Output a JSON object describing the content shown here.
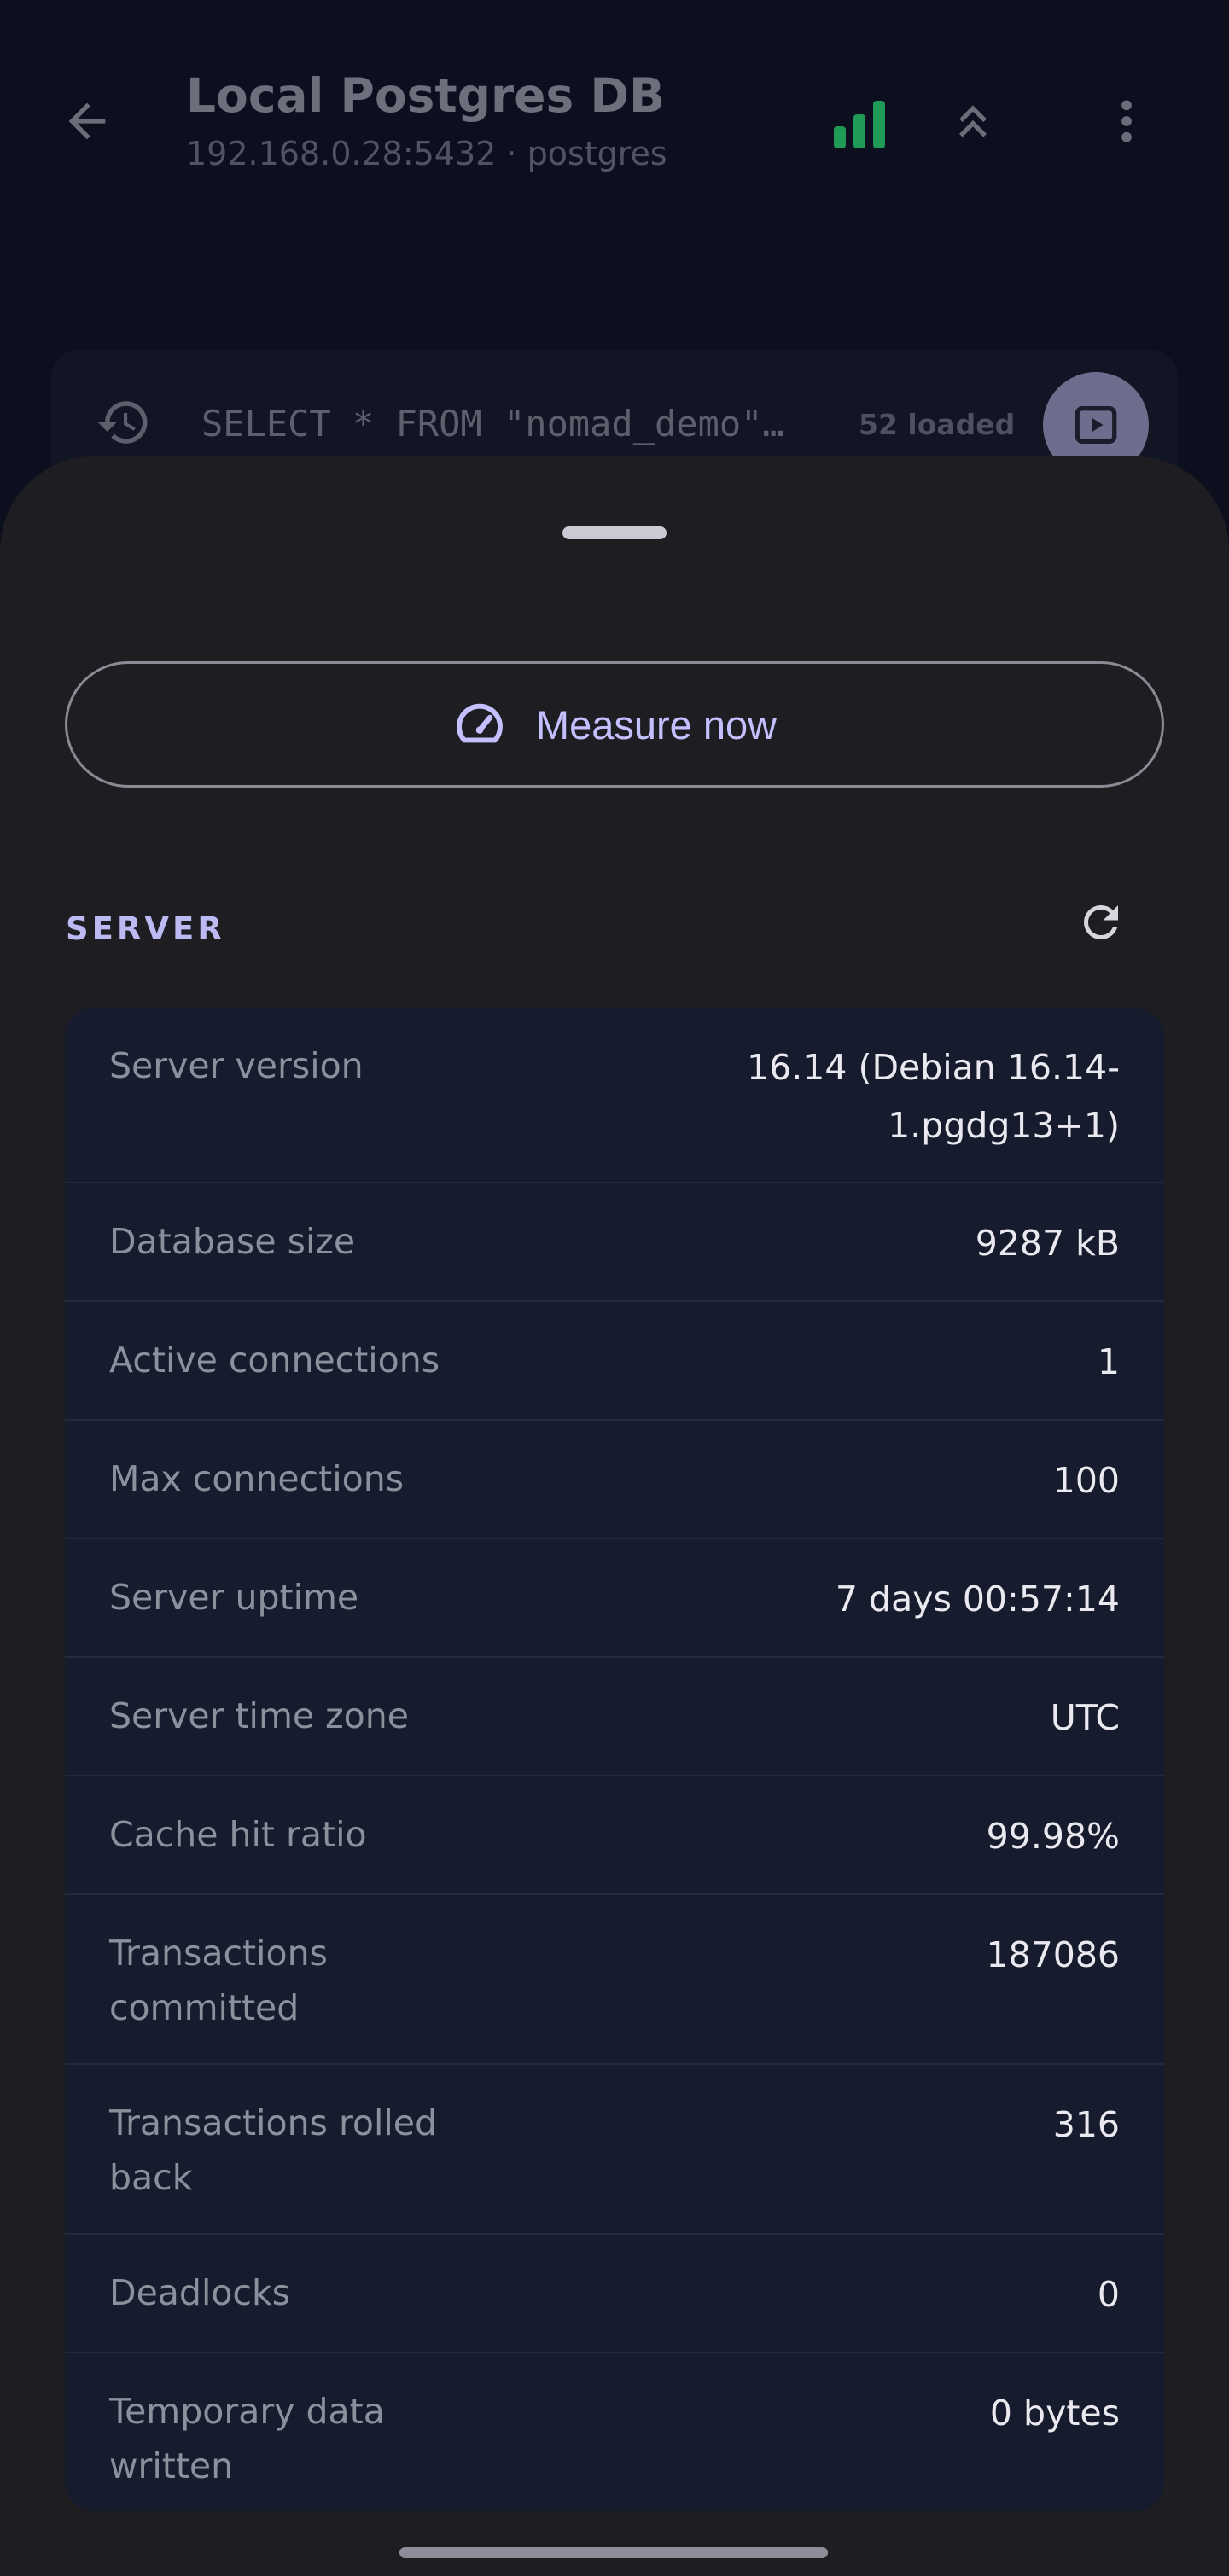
{
  "header": {
    "title": "Local Postgres DB",
    "subtitle": "192.168.0.28:5432 · postgres"
  },
  "query_bar": {
    "query": "SELECT * FROM \"nomad_demo\"…",
    "count": "52 loaded"
  },
  "sheet": {
    "measure_label": "Measure now",
    "section_title": "SERVER",
    "rows": [
      {
        "label": "Server version",
        "value": "16.14 (Debian 16.14-1.pgdg13+1)"
      },
      {
        "label": "Database size",
        "value": "9287 kB"
      },
      {
        "label": "Active connections",
        "value": "1"
      },
      {
        "label": "Max connections",
        "value": "100"
      },
      {
        "label": "Server uptime",
        "value": "7 days 00:57:14"
      },
      {
        "label": "Server time zone",
        "value": "UTC"
      },
      {
        "label": "Cache hit ratio",
        "value": "99.98%"
      },
      {
        "label": "Transactions committed",
        "value": "187086"
      },
      {
        "label": "Transactions rolled back",
        "value": "316"
      },
      {
        "label": "Deadlocks",
        "value": "0"
      },
      {
        "label": "Temporary data written",
        "value": "0 bytes"
      }
    ]
  },
  "colors": {
    "accent": "#c4c0ff",
    "signal_green": "#1f9a57",
    "sheet_bg": "#1d1d22",
    "table_bg": "#161c2d"
  },
  "icons": {
    "back": "arrow-left-icon",
    "signal": "signal-bars-icon",
    "collapse": "double-chevron-up-icon",
    "more": "more-vertical-icon",
    "history": "history-icon",
    "run": "play-icon",
    "measure": "speedometer-icon",
    "refresh": "refresh-icon"
  }
}
